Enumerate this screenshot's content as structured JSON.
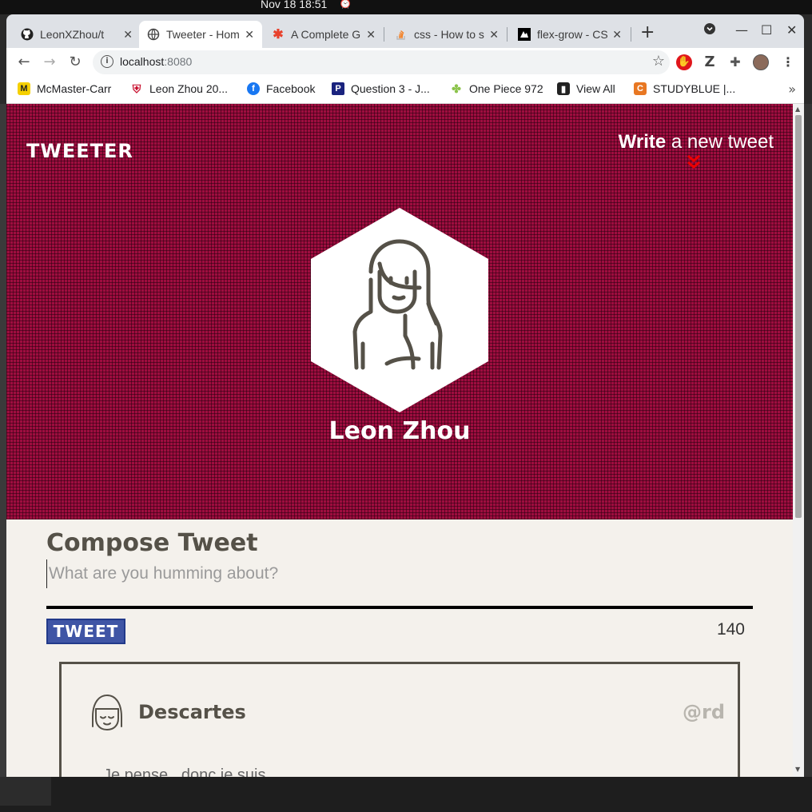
{
  "os": {
    "clock": "Nov 18  18:51"
  },
  "tabs": [
    {
      "title": "LeonXZhou/t",
      "icon": "github-icon"
    },
    {
      "title": "Tweeter - Hom",
      "icon": "globe-icon"
    },
    {
      "title": "A Complete G",
      "icon": "asterisk-icon"
    },
    {
      "title": "css - How to s",
      "icon": "stackoverflow-icon"
    },
    {
      "title": "flex-grow - CS",
      "icon": "mdn-icon"
    }
  ],
  "address_bar": {
    "host": "localhost",
    "port": ":8080"
  },
  "bookmarks": [
    {
      "label": "McMaster-Carr",
      "icon": "mcmaster-icon"
    },
    {
      "label": "Leon Zhou 20...",
      "icon": "shield-icon"
    },
    {
      "label": "Facebook",
      "icon": "facebook-icon"
    },
    {
      "label": "Question 3 - J...",
      "icon": "p-icon"
    },
    {
      "label": "One Piece 972",
      "icon": "frog-icon"
    },
    {
      "label": "View All",
      "icon": "book-icon"
    },
    {
      "label": "STUDYBLUE |...",
      "icon": "studyblue-icon"
    }
  ],
  "page": {
    "brand": "TWEETER",
    "write_bold": "Write",
    "write_rest": " a new tweet",
    "profile_name": "Leon Zhou",
    "compose_title": "Compose Tweet",
    "compose_placeholder": "What are you humming about?",
    "tweet_button": "TWEET",
    "char_counter": "140",
    "tweets": [
      {
        "name": "Descartes",
        "handle": "@rd",
        "text": "Je pense , donc je suis"
      }
    ]
  },
  "colors": {
    "hero": "#9e0d3f",
    "compose_text": "#555148",
    "tweet_button": "#3f55a5"
  }
}
